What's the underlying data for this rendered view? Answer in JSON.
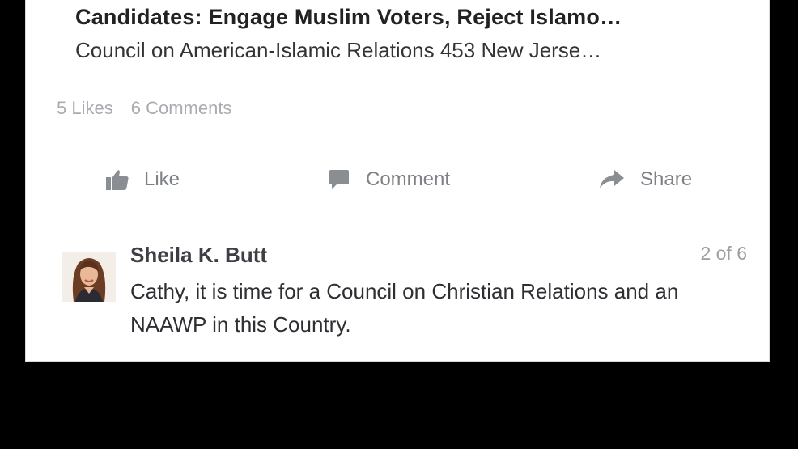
{
  "link_preview": {
    "title": "Candidates: Engage Muslim Voters, Reject Islamo…",
    "source": "Council on American-Islamic Relations 453 New Jerse…"
  },
  "stats": {
    "likes": "5 Likes",
    "comments": "6 Comments"
  },
  "actions": {
    "like": {
      "label": "Like",
      "icon": "thumbs-up-icon"
    },
    "comment": {
      "label": "Comment",
      "icon": "speech-bubble-icon"
    },
    "share": {
      "label": "Share",
      "icon": "share-arrow-icon"
    }
  },
  "comment": {
    "author": "Sheila K. Butt",
    "counter": "2 of 6",
    "text": "Cathy, it is time for a Council on Christian Relations and an NAAWP in this Country."
  },
  "colors": {
    "background": "#000000",
    "card": "#ffffff",
    "action_gray": "#7d8085",
    "muted": "#a8abb0"
  }
}
